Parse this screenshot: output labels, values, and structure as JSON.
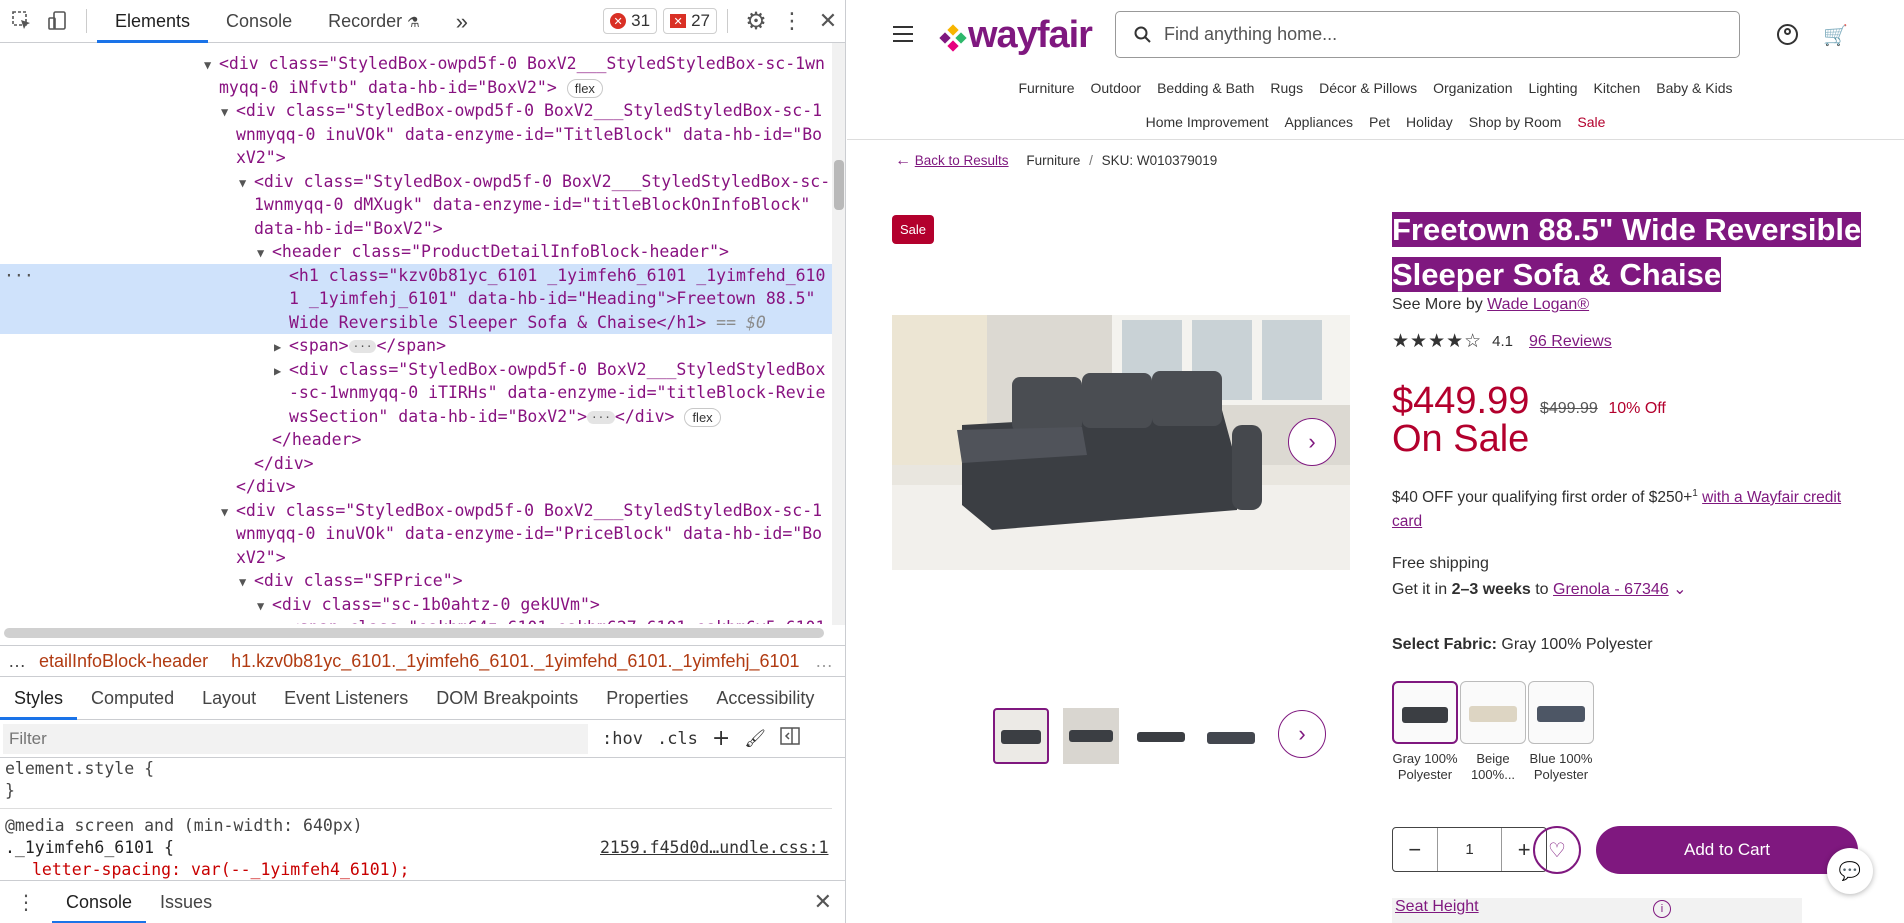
{
  "devtools": {
    "tabs": [
      "Elements",
      "Console",
      "Recorder"
    ],
    "more_tabs": "»",
    "errors": "31",
    "warnings": "27",
    "code": {
      "l1": "<div class=\"StyledBox-owpd5f-0 BoxV2___StyledStyledBox-sc-1wn",
      "l2": "myqq-0 iNfvtb\" data-hb-id=\"BoxV2\">",
      "l3": "<div class=\"StyledBox-owpd5f-0 BoxV2___StyledStyledBox-sc-1",
      "l4": "wnmyqq-0 inuVOk\" data-enzyme-id=\"TitleBlock\" data-hb-id=\"Bo",
      "l5": "xV2\">",
      "l6": "<div class=\"StyledBox-owpd5f-0 BoxV2___StyledStyledBox-sc-",
      "l7": "1wnmyqq-0 dMXugk\" data-enzyme-id=\"titleBlockOnInfoBlock\"",
      "l8": "data-hb-id=\"BoxV2\">",
      "l9": "<header class=\"ProductDetailInfoBlock-header\">",
      "l10": "<h1 class=\"kzv0b81yc_6101 _1yimfeh6_6101 _1yimfehd_610",
      "l11": "1 _1yimfehj_6101\" data-hb-id=\"Heading\">Freetown 88.5\"",
      "l12": "Wide Reversible Sleeper Sofa & Chaise</h1>",
      "l12b": " == $0",
      "l13": "<span>",
      "l13b": "</span>",
      "l14": "<div class=\"StyledBox-owpd5f-0 BoxV2___StyledStyledBox",
      "l15": "-sc-1wnmyqq-0 iTIRHs\" data-enzyme-id=\"titleBlock-Revie",
      "l16": "wsSection\" data-hb-id=\"BoxV2\">",
      "l16b": "</div>",
      "l17": "</header>",
      "l18": "</div>",
      "l19": "</div>",
      "l20": "<div class=\"StyledBox-owpd5f-0 BoxV2___StyledStyledBox-sc-1",
      "l21": "wnmyqq-0 inuVOk\" data-enzyme-id=\"PriceBlock\" data-hb-id=\"Bo",
      "l22": "xV2\">",
      "l23": "<div class=\"SFPrice\">",
      "l24": "<div class=\"sc-1b0ahtz-0 gekUVm\">",
      "l25": "<span class=\"oakhm64z_6101 oakhm627_6101 oakhm6v5_6101",
      "flex": "flex",
      "dots": "···"
    },
    "breadcrumb": {
      "a": "etailInfoBlock-header",
      "b": "h1.kzv0b81yc_6101._1yimfeh6_6101._1yimfehd_6101._1yimfehj_6101"
    },
    "style_tabs": [
      "Styles",
      "Computed",
      "Layout",
      "Event Listeners",
      "DOM Breakpoints",
      "Properties",
      "Accessibility"
    ],
    "filter_placeholder": "Filter",
    "hov": ":hov",
    "cls": ".cls",
    "styles": {
      "s1": "element.style {",
      "s2": "}",
      "s3": "@media screen and (min-width: 640px)",
      "s4": "._1yimfeh6_6101 {",
      "s4b": "2159.f45d0d…undle.css:1",
      "s5": "letter-spacing: var(--_1yimfeh4_6101);"
    },
    "drawer_tabs": [
      "Console",
      "Issues"
    ]
  },
  "site": {
    "logo": "wayfair",
    "search_placeholder": "Find anything home...",
    "nav1": [
      "Furniture",
      "Outdoor",
      "Bedding & Bath",
      "Rugs",
      "Décor & Pillows",
      "Organization",
      "Lighting",
      "Kitchen",
      "Baby & Kids"
    ],
    "nav2": [
      "Home Improvement",
      "Appliances",
      "Pet",
      "Holiday",
      "Shop by Room",
      "Sale"
    ],
    "back": "Back to Results",
    "crumb_cat": "Furniture",
    "sku": "SKU: W010379019",
    "sale_badge": "Sale",
    "title_l1": "Freetown 88.5\" Wide Reversible",
    "title_l2": "Sleeper Sofa & Chaise",
    "see_more": "See More by",
    "brand": "Wade Logan®",
    "rating": "4.1",
    "stars_shown": 4,
    "reviews": "96 Reviews",
    "price": "$449.99",
    "was": "$499.99",
    "off": "10% Off",
    "on_sale": "On Sale",
    "promo_a": "$40 OFF your qualifying first order of $250+",
    "promo_sup": "1",
    "promo_link": "with a Wayfair credit card",
    "ship": "Free shipping",
    "get_it": "Get it in",
    "weeks": "2–3 weeks",
    "to": "to",
    "location": "Grenola - 67346",
    "fabric_label": "Select Fabric:",
    "fabric_value": "Gray 100% Polyester",
    "swatches": [
      {
        "l1": "Gray 100%",
        "l2": "Polyester"
      },
      {
        "l1": "Beige",
        "l2": "100%..."
      },
      {
        "l1": "Blue 100%",
        "l2": "Polyester"
      }
    ],
    "qty": "1",
    "add_cart": "Add to Cart",
    "seat_height": "Seat Height"
  }
}
